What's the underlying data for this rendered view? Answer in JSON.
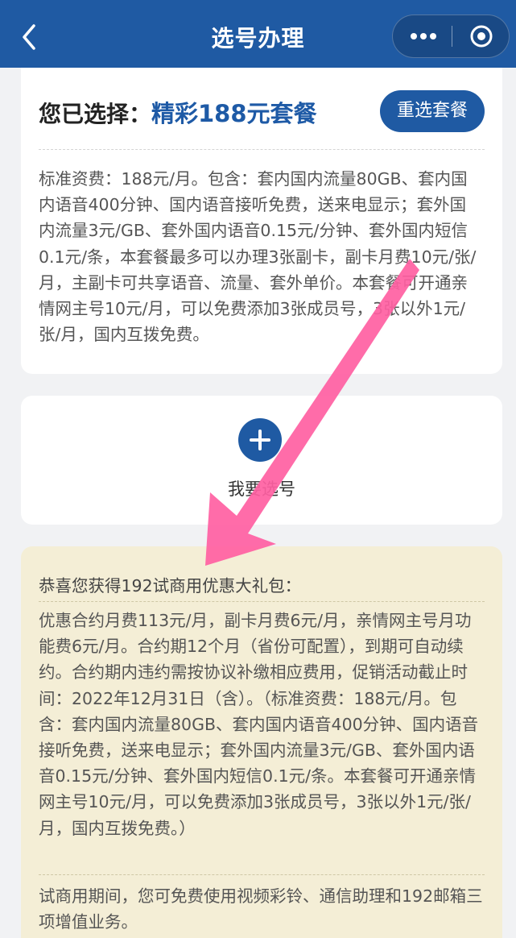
{
  "header": {
    "title": "选号办理"
  },
  "selection": {
    "label": "您已选择：",
    "plan_name": "精彩188元套餐",
    "reselect_label": "重选套餐",
    "description": "标准资费：188元/月。包含：套内国内流量80GB、套内国内语音400分钟、国内语音接听免费，送来电显示；套外国内流量3元/GB、套外国内语音0.15元/分钟、套外国内短信0.1元/条，本套餐最多可以办理3张副卡，副卡月费10元/张/月，主副卡可共享语音、流量、套外单价。本套餐可开通亲情网主号10元/月，可以免费添加3张成员号，3张以外1元/张/月，国内互拨免费。"
  },
  "number_picker": {
    "label": "我要选号"
  },
  "gift": {
    "title": "恭喜您获得192试商用优惠大礼包：",
    "description": "优惠合约月费113元/月，副卡月费6元/月，亲情网主号月功能费6元/月。合约期12个月（省份可配置），到期可自动续约。合约期内违约需按协议补缴相应费用，促销活动截止时间：2022年12月31日（含）。（标准资费：188元/月。包含：套内国内流量80GB、套内国内语音400分钟、国内语音接听免费，送来电显示；套外国内流量3元/GB、套外国内语音0.15元/分钟、套外国内短信0.1元/条。本套餐可开通亲情网主号10元/月，可以免费添加3张成员号，3张以外1元/张/月，国内互拨免费。）",
    "extra": "试商用期间，您可免费使用视频彩铃、通信助理和192邮箱三项增值业务。"
  },
  "colors": {
    "brand": "#1f5aa3",
    "gift_bg": "#f4eed6",
    "annotation_arrow": "#ff5fa2"
  },
  "icons": {
    "back": "back-arrow-icon",
    "more": "more-dots-icon",
    "close": "target-circle-icon",
    "add": "plus-icon"
  }
}
